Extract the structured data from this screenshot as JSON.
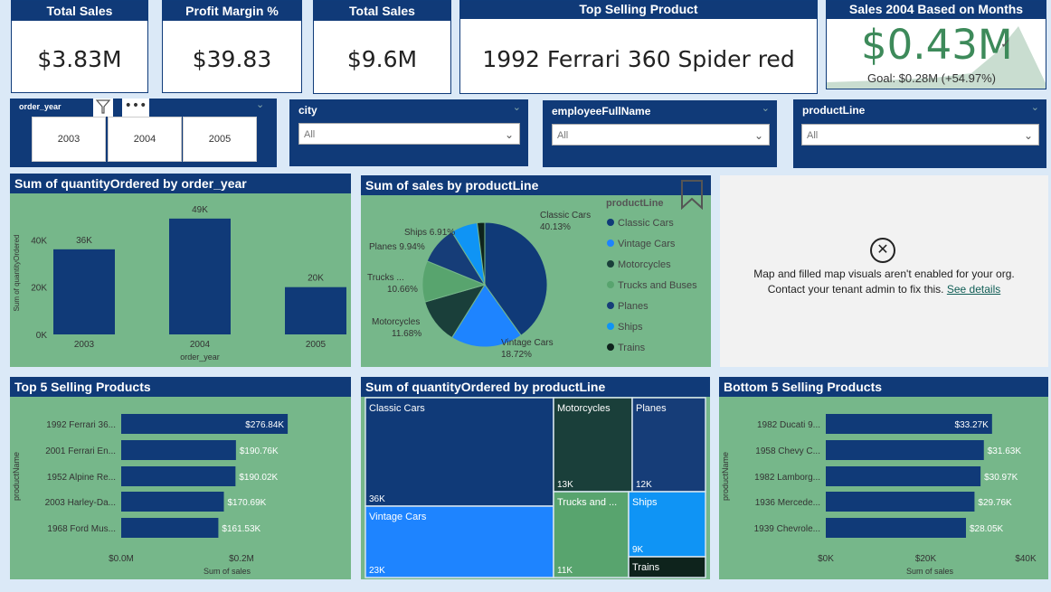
{
  "kpis": {
    "total_sales_1": {
      "title": "Total Sales",
      "value": "$3.83M"
    },
    "profit_margin": {
      "title": "Profit Margin %",
      "value": "$39.83"
    },
    "total_sales_2": {
      "title": "Total Sales",
      "value": "$9.6M"
    },
    "top_product": {
      "title": "Top Selling Product",
      "value": "1992 Ferrari 360 Spider red"
    },
    "sales_2004": {
      "title": "Sales 2004 Based on Months",
      "value": "$0.43M",
      "goal": "Goal: $0.28M (+54.97%)"
    }
  },
  "slicers": {
    "order_year": {
      "label": "order_year",
      "options": [
        "2003",
        "2004",
        "2005"
      ]
    },
    "city": {
      "label": "city",
      "value": "All"
    },
    "employee": {
      "label": "employeeFullName",
      "value": "All"
    },
    "productline": {
      "label": "productLine",
      "value": "All"
    }
  },
  "qty_by_year": {
    "title": "Sum of quantityOrdered by order_year",
    "chart_data": {
      "type": "bar",
      "categories": [
        "2003",
        "2004",
        "2005"
      ],
      "values": [
        36000,
        49000,
        20000
      ],
      "data_labels": [
        "36K",
        "49K",
        "20K"
      ],
      "xlabel": "order_year",
      "ylabel": "Sum of quantityOrdered",
      "yticks": [
        "0K",
        "20K",
        "40K"
      ],
      "ylim": [
        0,
        52000
      ]
    }
  },
  "sales_by_productline": {
    "title": "Sum of sales by productLine",
    "legend_title": "productLine",
    "chart_data": {
      "type": "pie",
      "slices": [
        {
          "name": "Classic Cars",
          "value": 40.13,
          "label": "Classic Cars",
          "pct": "40.13%",
          "color": "#103a78"
        },
        {
          "name": "Vintage Cars",
          "value": 18.72,
          "label": "Vintage Cars",
          "pct": "18.72%",
          "color": "#1e84ff"
        },
        {
          "name": "Motorcycles",
          "value": 11.68,
          "label": "Motorcycles",
          "pct": "11.68%",
          "color": "#1a3f3a"
        },
        {
          "name": "Trucks and Buses",
          "value": 10.66,
          "label": "Trucks ...",
          "pct": "10.66%",
          "color": "#58a46e"
        },
        {
          "name": "Planes",
          "value": 9.94,
          "label": "Planes 9.94%",
          "pct": "",
          "color": "#163d78"
        },
        {
          "name": "Ships",
          "value": 6.91,
          "label": "Ships 6.91%",
          "pct": "",
          "color": "#0f94f5"
        },
        {
          "name": "Trains",
          "value": 1.96,
          "label": "",
          "pct": "",
          "color": "#0e231c"
        }
      ]
    }
  },
  "map_notice": {
    "line1": "Map and filled map visuals aren't enabled for your org.",
    "line2": "Contact your tenant admin to fix this.",
    "link": "See details"
  },
  "top5": {
    "title": "Top 5 Selling Products",
    "chart_data": {
      "type": "bar",
      "orientation": "horizontal",
      "categories": [
        "1992 Ferrari 36...",
        "2001 Ferrari En...",
        "1952 Alpine Re...",
        "2003 Harley-Da...",
        "1968 Ford Mus..."
      ],
      "values": [
        276840,
        190760,
        190020,
        170690,
        161530
      ],
      "data_labels": [
        "$276.84K",
        "$190.76K",
        "$190.02K",
        "$170.69K",
        "$161.53K"
      ],
      "xlabel": "Sum of sales",
      "ylabel": "productName",
      "xticks": [
        "$0.0M",
        "$0.2M"
      ],
      "xlim": [
        0,
        400000
      ]
    }
  },
  "qty_by_productline": {
    "title": "Sum of quantityOrdered by productLine",
    "chart_data": {
      "type": "treemap",
      "items": [
        {
          "name": "Classic Cars",
          "value": "36K",
          "color": "#103a78"
        },
        {
          "name": "Vintage Cars",
          "value": "23K",
          "color": "#1e84ff"
        },
        {
          "name": "Motorcycles",
          "value": "13K",
          "color": "#1a3f3a"
        },
        {
          "name": "Trucks and ...",
          "value": "11K",
          "color": "#58a46e"
        },
        {
          "name": "Planes",
          "value": "12K",
          "color": "#163d78"
        },
        {
          "name": "Ships",
          "value": "9K",
          "color": "#0f94f5"
        },
        {
          "name": "Trains",
          "value": "",
          "color": "#0e231c"
        }
      ]
    }
  },
  "bottom5": {
    "title": "Bottom 5 Selling Products",
    "chart_data": {
      "type": "bar",
      "orientation": "horizontal",
      "categories": [
        "1982 Ducati 9...",
        "1958 Chevy C...",
        "1982 Lamborg...",
        "1936 Mercede...",
        "1939 Chevrole..."
      ],
      "values": [
        33270,
        31630,
        30970,
        29760,
        28050
      ],
      "data_labels": [
        "$33.27K",
        "$31.63K",
        "$30.97K",
        "$29.76K",
        "$28.05K"
      ],
      "xlabel": "Sum of sales",
      "ylabel": "productName",
      "xticks": [
        "$0K",
        "$20K",
        "$40K"
      ],
      "xlim": [
        0,
        40000
      ]
    }
  },
  "colors": {
    "navy": "#103a78",
    "panel_green": "#76b78a",
    "kpi_green": "#3d8a5a"
  }
}
